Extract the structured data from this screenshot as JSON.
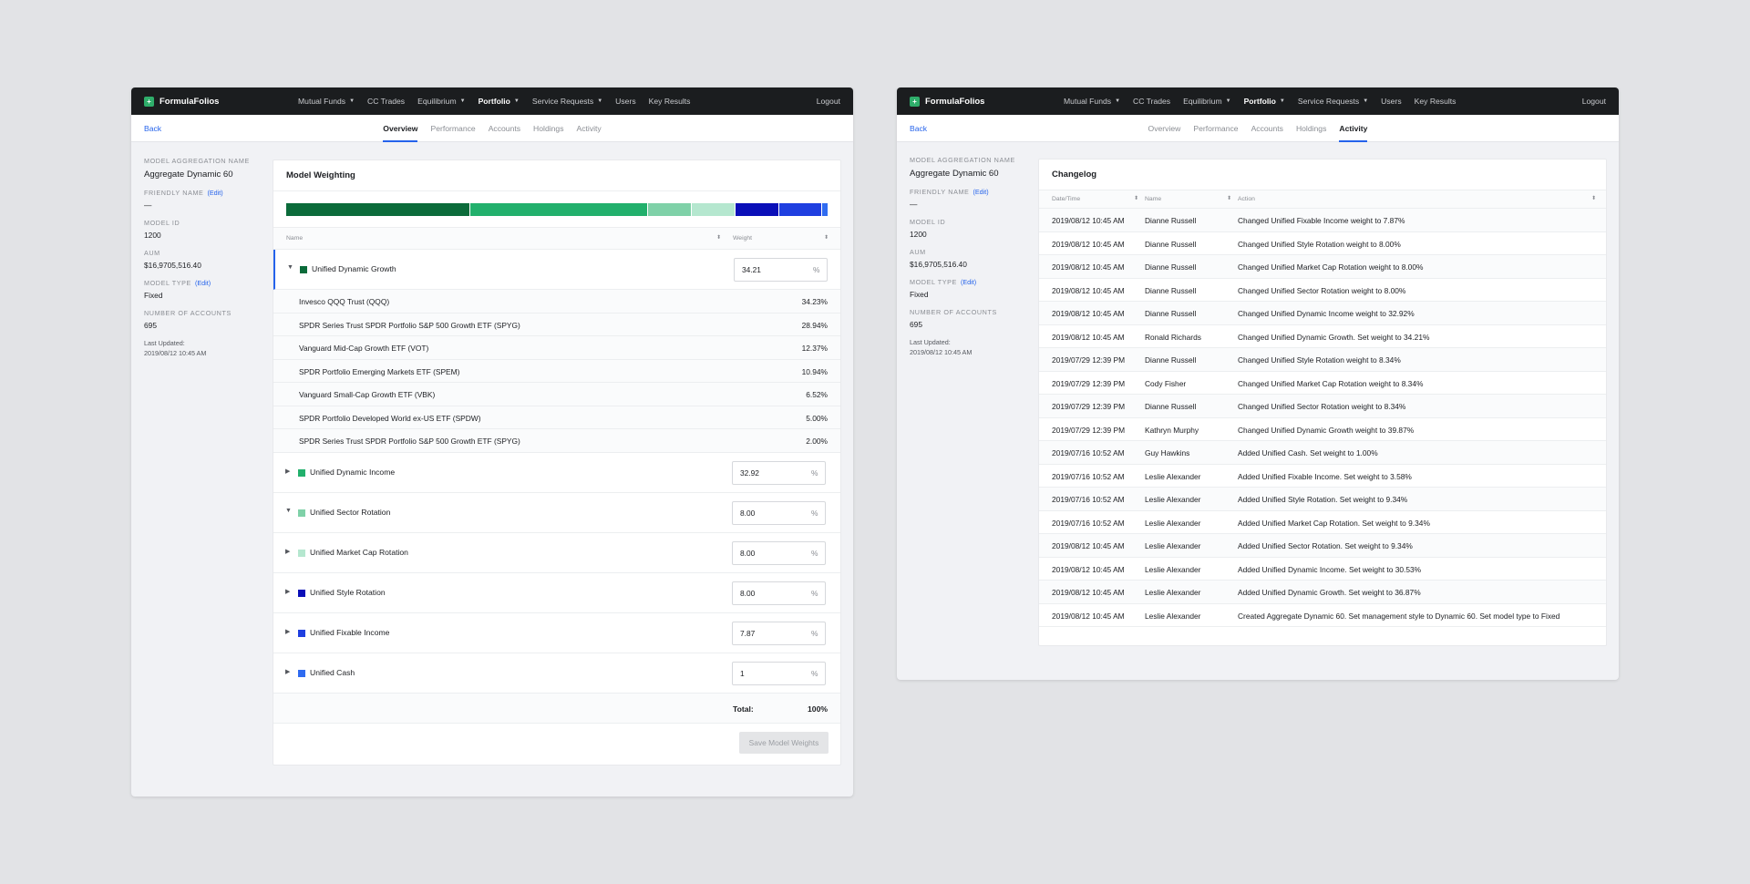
{
  "brand": "FormulaFolios",
  "brand_icon": "plus-icon",
  "nav": [
    {
      "label": "Mutual Funds",
      "caret": true
    },
    {
      "label": "CC Trades",
      "caret": false
    },
    {
      "label": "Equilibrium",
      "caret": true
    },
    {
      "label": "Portfolio",
      "caret": true
    },
    {
      "label": "Service Requests",
      "caret": true
    },
    {
      "label": "Users",
      "caret": false
    },
    {
      "label": "Key Results",
      "caret": false
    }
  ],
  "logout": "Logout",
  "back": "Back",
  "tabs": [
    "Overview",
    "Performance",
    "Accounts",
    "Holdings",
    "Activity"
  ],
  "sidebar": {
    "aggregation_label": "MODEL AGGREGATION NAME",
    "aggregation_value": "Aggregate Dynamic 60",
    "friendly_label": "FRIENDLY NAME",
    "friendly_edit": "(Edit)",
    "friendly_value": "—",
    "model_id_label": "MODEL ID",
    "model_id_value": "1200",
    "aum_label": "AUM",
    "aum_value": "$16,9705,516.40",
    "model_type_label": "MODEL TYPE",
    "model_type_edit": "(Edit)",
    "model_type_value": "Fixed",
    "accounts_label": "NUMBER OF ACCOUNTS",
    "accounts_value": "695",
    "updated_label": "Last Updated:",
    "updated_value": "2019/08/12 10:45 AM"
  },
  "left": {
    "active_tab": "Overview",
    "card_title": "Model Weighting",
    "col_name": "Name",
    "col_weight": "Weight",
    "weight_bar": [
      {
        "value": 34.21,
        "color": "#0b6b3a"
      },
      {
        "value": 32.92,
        "color": "#22b06c"
      },
      {
        "value": 8.0,
        "color": "#7fd1a8"
      },
      {
        "value": 8.0,
        "color": "#b5e7cf"
      },
      {
        "value": 8.0,
        "color": "#0a0fb8"
      },
      {
        "value": 7.87,
        "color": "#1f3fe0"
      },
      {
        "value": 1.0,
        "color": "#2f6bf0"
      }
    ],
    "groups": [
      {
        "name": "Unified Dynamic Growth",
        "weight": "34.21",
        "color": "#0b6b3a",
        "toggle": "▼",
        "expanded": true,
        "holdings": [
          {
            "name": "Invesco QQQ Trust (QQQ)",
            "weight": "34.23%"
          },
          {
            "name": "SPDR Series Trust SPDR Portfolio S&P 500 Growth ETF (SPYG)",
            "weight": "28.94%"
          },
          {
            "name": "Vanguard Mid-Cap Growth ETF (VOT)",
            "weight": "12.37%"
          },
          {
            "name": "SPDR Portfolio Emerging Markets ETF (SPEM)",
            "weight": "10.94%"
          },
          {
            "name": "Vanguard Small-Cap Growth ETF (VBK)",
            "weight": "6.52%"
          },
          {
            "name": "SPDR Portfolio Developed World ex-US ETF (SPDW)",
            "weight": "5.00%"
          },
          {
            "name": "SPDR Series Trust SPDR Portfolio S&P 500 Growth ETF (SPYG)",
            "weight": "2.00%"
          }
        ]
      },
      {
        "name": "Unified Dynamic Income",
        "weight": "32.92",
        "color": "#22b06c",
        "toggle": "▶",
        "expanded": false,
        "holdings": []
      },
      {
        "name": "Unified Sector Rotation",
        "weight": "8.00",
        "color": "#7fd1a8",
        "toggle": "▼",
        "expanded": false,
        "holdings": []
      },
      {
        "name": "Unified Market Cap Rotation",
        "weight": "8.00",
        "color": "#b5e7cf",
        "toggle": "▶",
        "expanded": false,
        "holdings": []
      },
      {
        "name": "Unified Style Rotation",
        "weight": "8.00",
        "color": "#0a0fb8",
        "toggle": "▶",
        "expanded": false,
        "holdings": []
      },
      {
        "name": "Unified Fixable Income",
        "weight": "7.87",
        "color": "#1f3fe0",
        "toggle": "▶",
        "expanded": false,
        "holdings": []
      },
      {
        "name": "Unified Cash",
        "weight": "1",
        "color": "#2f6bf0",
        "toggle": "▶",
        "expanded": false,
        "holdings": []
      }
    ],
    "pct_symbol": "%",
    "total_label": "Total:",
    "total_value": "100%",
    "save_label": "Save Model Weights"
  },
  "right": {
    "active_tab": "Activity",
    "card_title": "Changelog",
    "col_date": "Date/Time",
    "col_name": "Name",
    "col_action": "Action",
    "rows": [
      {
        "date": "2019/08/12 10:45 AM",
        "name": "Dianne Russell",
        "action": "Changed Unified Fixable Income weight to 7.87%"
      },
      {
        "date": "2019/08/12 10:45 AM",
        "name": "Dianne Russell",
        "action": "Changed Unified Style Rotation weight to 8.00%"
      },
      {
        "date": "2019/08/12 10:45 AM",
        "name": "Dianne Russell",
        "action": "Changed Unified Market Cap Rotation weight to 8.00%"
      },
      {
        "date": "2019/08/12 10:45 AM",
        "name": "Dianne Russell",
        "action": "Changed Unified Sector Rotation weight to 8.00%"
      },
      {
        "date": "2019/08/12 10:45 AM",
        "name": "Dianne Russell",
        "action": "Changed Unified Dynamic Income weight to 32.92%"
      },
      {
        "date": "2019/08/12 10:45 AM",
        "name": "Ronald Richards",
        "action": "Changed Unified Dynamic Growth. Set weight to 34.21%"
      },
      {
        "date": "2019/07/29 12:39 PM",
        "name": "Dianne Russell",
        "action": "Changed Unified Style Rotation weight to 8.34%"
      },
      {
        "date": "2019/07/29 12:39 PM",
        "name": "Cody Fisher",
        "action": "Changed Unified Market Cap Rotation weight to 8.34%"
      },
      {
        "date": "2019/07/29 12:39 PM",
        "name": "Dianne Russell",
        "action": "Changed Unified Sector Rotation weight to 8.34%"
      },
      {
        "date": "2019/07/29 12:39 PM",
        "name": "Kathryn Murphy",
        "action": "Changed Unified Dynamic Growth weight to 39.87%"
      },
      {
        "date": "2019/07/16 10:52 AM",
        "name": "Guy Hawkins",
        "action": "Added Unified Cash. Set weight to 1.00%"
      },
      {
        "date": "2019/07/16 10:52 AM",
        "name": "Leslie Alexander",
        "action": "Added Unified Fixable Income. Set weight to 3.58%"
      },
      {
        "date": "2019/07/16 10:52 AM",
        "name": "Leslie Alexander",
        "action": "Added Unified Style Rotation. Set weight to 9.34%"
      },
      {
        "date": "2019/07/16 10:52 AM",
        "name": "Leslie Alexander",
        "action": "Added Unified Market Cap Rotation. Set weight to 9.34%"
      },
      {
        "date": "2019/08/12 10:45 AM",
        "name": "Leslie Alexander",
        "action": "Added Unified Sector Rotation. Set weight to 9.34%"
      },
      {
        "date": "2019/08/12 10:45 AM",
        "name": "Leslie Alexander",
        "action": "Added Unified Dynamic Income. Set weight to 30.53%"
      },
      {
        "date": "2019/08/12 10:45 AM",
        "name": "Leslie Alexander",
        "action": "Added Unified Dynamic Growth. Set weight to 36.87%"
      },
      {
        "date": "2019/08/12 10:45 AM",
        "name": "Leslie Alexander",
        "action": "Created Aggregate Dynamic 60. Set management style to Dynamic 60. Set model type to Fixed"
      }
    ]
  }
}
